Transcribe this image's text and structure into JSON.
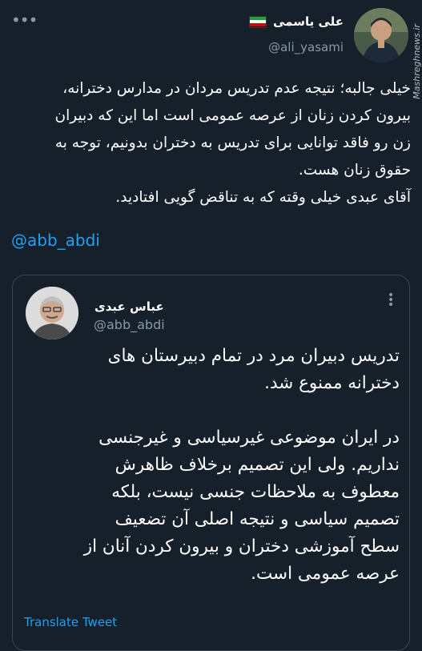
{
  "tweet": {
    "author_name": "علی یاسمی",
    "author_handle": "@ali_yasami",
    "watermark": "Mashreghnews.ir",
    "text_lines": [
      "خیلی جالبه؛ نتیجه عدم تدریس مردان در مدارس دخترانه،",
      "بیرون کردن زنان از عرصه عمومی است اما این که دبیران",
      "زن رو فاقد توانایی برای تدریس به دختران بدونیم، توجه به",
      "حقوق زنان هست.",
      "آقای عبدی خیلی وقته که به تناقض گویی افتادید."
    ],
    "mention": "@abb_abdi",
    "more_icon": "more-dots-icon"
  },
  "quoted": {
    "author_name": "عباس عبدی",
    "author_handle": "@abb_abdi",
    "text_lines": [
      "تدریس دبیران مرد در تمام دبیرستان های",
      "دخترانه ممنوع شد.",
      "",
      "در ایران موضوعی غیرسیاسی و غیرجنسی",
      "نداریم. ولی این تصمیم برخلاف ظاهرش",
      "معطوف به ملاحظات جنسی نیست، بلکه",
      "تصمیم سیاسی و نتیجه اصلی آن تضعیف",
      "سطح آموزشی دختران و بیرون کردن آنان از",
      "عرصه عمومی است."
    ],
    "translate_label": "Translate Tweet"
  },
  "colors": {
    "background": "#15202b",
    "text": "#ffffff",
    "secondary": "#8899a6",
    "link": "#1da1f2",
    "border": "#38444d"
  }
}
